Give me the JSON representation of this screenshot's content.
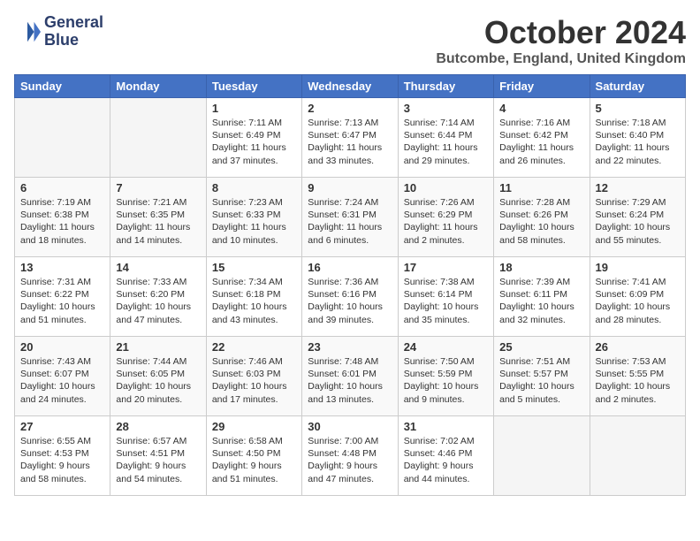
{
  "header": {
    "logo_line1": "General",
    "logo_line2": "Blue",
    "month_title": "October 2024",
    "location": "Butcombe, England, United Kingdom"
  },
  "weekdays": [
    "Sunday",
    "Monday",
    "Tuesday",
    "Wednesday",
    "Thursday",
    "Friday",
    "Saturday"
  ],
  "weeks": [
    [
      {
        "day": "",
        "detail": ""
      },
      {
        "day": "",
        "detail": ""
      },
      {
        "day": "1",
        "detail": "Sunrise: 7:11 AM\nSunset: 6:49 PM\nDaylight: 11 hours\nand 37 minutes."
      },
      {
        "day": "2",
        "detail": "Sunrise: 7:13 AM\nSunset: 6:47 PM\nDaylight: 11 hours\nand 33 minutes."
      },
      {
        "day": "3",
        "detail": "Sunrise: 7:14 AM\nSunset: 6:44 PM\nDaylight: 11 hours\nand 29 minutes."
      },
      {
        "day": "4",
        "detail": "Sunrise: 7:16 AM\nSunset: 6:42 PM\nDaylight: 11 hours\nand 26 minutes."
      },
      {
        "day": "5",
        "detail": "Sunrise: 7:18 AM\nSunset: 6:40 PM\nDaylight: 11 hours\nand 22 minutes."
      }
    ],
    [
      {
        "day": "6",
        "detail": "Sunrise: 7:19 AM\nSunset: 6:38 PM\nDaylight: 11 hours\nand 18 minutes."
      },
      {
        "day": "7",
        "detail": "Sunrise: 7:21 AM\nSunset: 6:35 PM\nDaylight: 11 hours\nand 14 minutes."
      },
      {
        "day": "8",
        "detail": "Sunrise: 7:23 AM\nSunset: 6:33 PM\nDaylight: 11 hours\nand 10 minutes."
      },
      {
        "day": "9",
        "detail": "Sunrise: 7:24 AM\nSunset: 6:31 PM\nDaylight: 11 hours\nand 6 minutes."
      },
      {
        "day": "10",
        "detail": "Sunrise: 7:26 AM\nSunset: 6:29 PM\nDaylight: 11 hours\nand 2 minutes."
      },
      {
        "day": "11",
        "detail": "Sunrise: 7:28 AM\nSunset: 6:26 PM\nDaylight: 10 hours\nand 58 minutes."
      },
      {
        "day": "12",
        "detail": "Sunrise: 7:29 AM\nSunset: 6:24 PM\nDaylight: 10 hours\nand 55 minutes."
      }
    ],
    [
      {
        "day": "13",
        "detail": "Sunrise: 7:31 AM\nSunset: 6:22 PM\nDaylight: 10 hours\nand 51 minutes."
      },
      {
        "day": "14",
        "detail": "Sunrise: 7:33 AM\nSunset: 6:20 PM\nDaylight: 10 hours\nand 47 minutes."
      },
      {
        "day": "15",
        "detail": "Sunrise: 7:34 AM\nSunset: 6:18 PM\nDaylight: 10 hours\nand 43 minutes."
      },
      {
        "day": "16",
        "detail": "Sunrise: 7:36 AM\nSunset: 6:16 PM\nDaylight: 10 hours\nand 39 minutes."
      },
      {
        "day": "17",
        "detail": "Sunrise: 7:38 AM\nSunset: 6:14 PM\nDaylight: 10 hours\nand 35 minutes."
      },
      {
        "day": "18",
        "detail": "Sunrise: 7:39 AM\nSunset: 6:11 PM\nDaylight: 10 hours\nand 32 minutes."
      },
      {
        "day": "19",
        "detail": "Sunrise: 7:41 AM\nSunset: 6:09 PM\nDaylight: 10 hours\nand 28 minutes."
      }
    ],
    [
      {
        "day": "20",
        "detail": "Sunrise: 7:43 AM\nSunset: 6:07 PM\nDaylight: 10 hours\nand 24 minutes."
      },
      {
        "day": "21",
        "detail": "Sunrise: 7:44 AM\nSunset: 6:05 PM\nDaylight: 10 hours\nand 20 minutes."
      },
      {
        "day": "22",
        "detail": "Sunrise: 7:46 AM\nSunset: 6:03 PM\nDaylight: 10 hours\nand 17 minutes."
      },
      {
        "day": "23",
        "detail": "Sunrise: 7:48 AM\nSunset: 6:01 PM\nDaylight: 10 hours\nand 13 minutes."
      },
      {
        "day": "24",
        "detail": "Sunrise: 7:50 AM\nSunset: 5:59 PM\nDaylight: 10 hours\nand 9 minutes."
      },
      {
        "day": "25",
        "detail": "Sunrise: 7:51 AM\nSunset: 5:57 PM\nDaylight: 10 hours\nand 5 minutes."
      },
      {
        "day": "26",
        "detail": "Sunrise: 7:53 AM\nSunset: 5:55 PM\nDaylight: 10 hours\nand 2 minutes."
      }
    ],
    [
      {
        "day": "27",
        "detail": "Sunrise: 6:55 AM\nSunset: 4:53 PM\nDaylight: 9 hours\nand 58 minutes."
      },
      {
        "day": "28",
        "detail": "Sunrise: 6:57 AM\nSunset: 4:51 PM\nDaylight: 9 hours\nand 54 minutes."
      },
      {
        "day": "29",
        "detail": "Sunrise: 6:58 AM\nSunset: 4:50 PM\nDaylight: 9 hours\nand 51 minutes."
      },
      {
        "day": "30",
        "detail": "Sunrise: 7:00 AM\nSunset: 4:48 PM\nDaylight: 9 hours\nand 47 minutes."
      },
      {
        "day": "31",
        "detail": "Sunrise: 7:02 AM\nSunset: 4:46 PM\nDaylight: 9 hours\nand 44 minutes."
      },
      {
        "day": "",
        "detail": ""
      },
      {
        "day": "",
        "detail": ""
      }
    ]
  ]
}
